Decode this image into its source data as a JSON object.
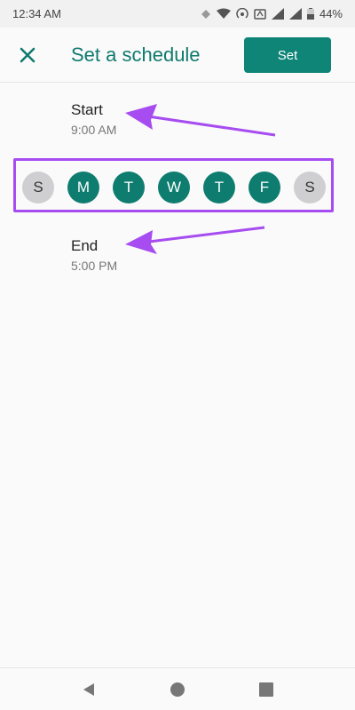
{
  "status_bar": {
    "time": "12:34 AM",
    "battery": "44%"
  },
  "app_bar": {
    "title": "Set a schedule",
    "set_label": "Set",
    "close_icon": "close-icon"
  },
  "schedule": {
    "start": {
      "label": "Start",
      "time": "9:00 AM"
    },
    "end": {
      "label": "End",
      "time": "5:00 PM"
    },
    "days": [
      {
        "letter": "S",
        "selected": false
      },
      {
        "letter": "M",
        "selected": true
      },
      {
        "letter": "T",
        "selected": true
      },
      {
        "letter": "W",
        "selected": true
      },
      {
        "letter": "T",
        "selected": true
      },
      {
        "letter": "F",
        "selected": true
      },
      {
        "letter": "S",
        "selected": false
      }
    ]
  },
  "colors": {
    "accent": "#0e7d70",
    "annotation": "#a64cf0",
    "unselected": "#cfcfd1"
  },
  "nav_bar": {
    "icons": [
      "back-icon",
      "home-icon",
      "recents-icon"
    ]
  }
}
